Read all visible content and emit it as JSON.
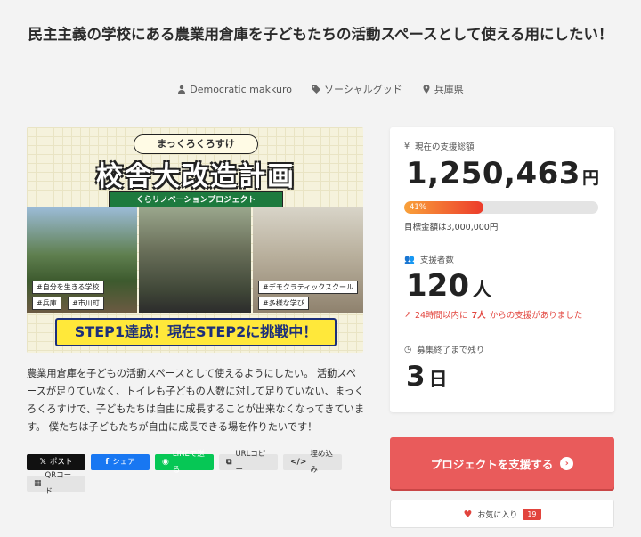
{
  "project": {
    "title": "民主主義の学校にある農業用倉庫を子どもたちの活動スペースとして使える用にしたい！",
    "owner": "Democratic makkuro",
    "category": "ソーシャルグッド",
    "location": "兵庫県"
  },
  "hero": {
    "top_badge": "まっくろくろすけ",
    "headline": "校舎大改造計画",
    "subheadline": "くらリノベーションプロジェクト",
    "tags": [
      "#自分を生きる学校",
      "#兵庫",
      "#市川町",
      "#デモクラティックスクール",
      "#多様な学び"
    ],
    "ribbon": "STEP1達成！現在STEP2に挑戦中！"
  },
  "description": "農業用倉庫を子どもの活動スペースとして使えるようにしたい。 活動スペースが足りていなく、トイレも子どもの人数に対して足りていない、まっくろくろすけで、子どもたちは自由に成長することが出来なくなってきています。 僕たちは子どもたちが自由に成長できる場を作りたいです！",
  "share": {
    "post": "ポスト",
    "share": "シェア",
    "line": "LINEで送る",
    "url_copy": "URLコピー",
    "embed": "埋め込み",
    "qr": "QRコード"
  },
  "stats": {
    "amount_label": "現在の支援総額",
    "amount": "1,250,463",
    "amount_unit": "円",
    "progress_label": "41%",
    "progress_percent": 41,
    "goal_text": "目標金額は3,000,000円",
    "supporters_label": "支援者数",
    "supporters": "120",
    "supporters_unit": "人",
    "trend_prefix": "24時間以内に",
    "trend_count": "7人",
    "trend_suffix": "からの支援がありました",
    "remaining_label": "募集終了まで残り",
    "remaining": "3",
    "remaining_unit": "日"
  },
  "actions": {
    "support_label": "プロジェクトを支援する",
    "favorite_label": "お気に入り",
    "favorite_count": "19"
  },
  "colors": {
    "accent": "#e95b5b",
    "progress_start": "#f9a13a",
    "progress_end": "#ec3b2b",
    "trend": "#e2443d"
  }
}
